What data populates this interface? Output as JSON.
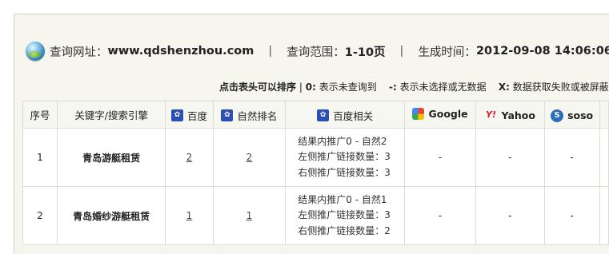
{
  "info_bar": {
    "query_url_label": "查询网址：",
    "query_url": "www.qdshenzhou.com",
    "separator": "|",
    "range_label": "查询范围：",
    "range_value": "1-10页",
    "time_label": "生成时间：",
    "time_value": "2012-09-08 14:06:06"
  },
  "legend": {
    "sort_hint": "点击表头可以排序",
    "sep": "|",
    "zero_key": "0:",
    "zero_text": "表示未查询到",
    "dash_key": "-:",
    "dash_text": "表示未选择或无数据",
    "x_key": "X:",
    "x_text": "数据获取失败或被屏蔽"
  },
  "table": {
    "headers": {
      "index": "序号",
      "keyword": "关键字/搜索引擎",
      "baidu": "百度",
      "natural_rank": "自然排名",
      "baidu_related": "百度相关",
      "google": "Google",
      "yahoo": "Yahoo",
      "soso": "soso"
    },
    "header_icons": {
      "baidu": "baidu-paw-icon",
      "google": "google-icon",
      "yahoo": "yahoo-icon",
      "soso": "soso-icon"
    },
    "rows": [
      {
        "index": "1",
        "keyword": "青岛游艇租赁",
        "baidu": "2",
        "natural_rank": "2",
        "related": [
          "结果内推广0 - 自然2",
          "左侧推广链接数量：3",
          "右侧推广链接数量：3"
        ],
        "google": "-",
        "yahoo": "-",
        "soso": "-"
      },
      {
        "index": "2",
        "keyword": "青岛婚纱游艇租赁",
        "baidu": "1",
        "natural_rank": "1",
        "related": [
          "结果内推广0 - 自然1",
          "左侧推广链接数量：3",
          "右侧推广链接数量：2"
        ],
        "google": "-",
        "yahoo": "-",
        "soso": "-"
      }
    ]
  },
  "colors": {
    "panel_bg": "#f6f6ee",
    "border": "#dedcd0",
    "header_bg": "#f7f7f2",
    "baidu_blue": "#2b4fb5",
    "yahoo_red": "#d61e2a"
  }
}
